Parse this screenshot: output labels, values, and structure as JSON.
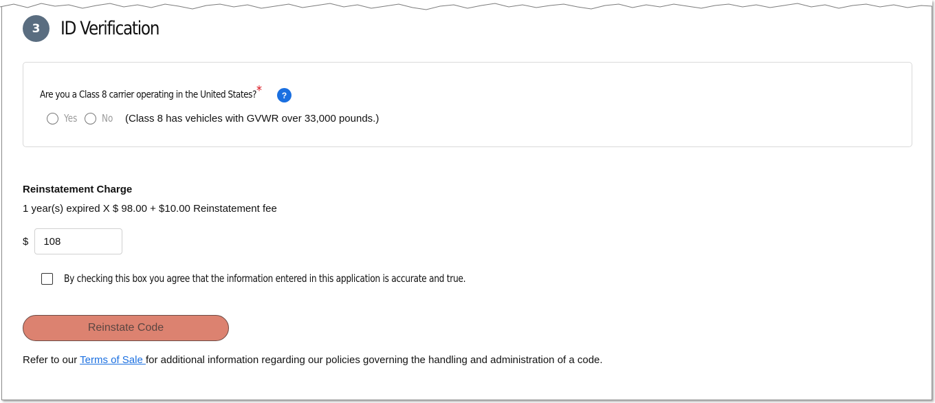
{
  "step": {
    "number": "3",
    "title": "ID Verification"
  },
  "question": {
    "label": "Are you a Class 8 carrier operating in the United States?",
    "required_mark": "*",
    "help_icon_text": "?",
    "options": [
      {
        "label": "Yes",
        "selected": false
      },
      {
        "label": "No",
        "selected": false
      }
    ],
    "note": "(Class 8 has vehicles with GVWR over 33,000 pounds.)"
  },
  "reinstatement": {
    "title": "Reinstatement Charge",
    "detail": "1 year(s) expired X $ 98.00 + $10.00 Reinstatement fee",
    "currency": "$",
    "amount_value": "108"
  },
  "agreement": {
    "label": "By checking this box you agree that the information entered in this application is accurate and true.",
    "checked": false
  },
  "actions": {
    "reinstate_label": "Reinstate Code"
  },
  "footer": {
    "prefix": "Refer to our ",
    "link_text": "Terms of Sale ",
    "suffix": "for additional information regarding our policies governing the handling and administration of a code."
  },
  "colors": {
    "badge": "#5a6d80",
    "required": "#d9141e",
    "help_icon": "#1a6fe0",
    "button_bg": "#dc8270",
    "link": "#1a6fe0"
  }
}
